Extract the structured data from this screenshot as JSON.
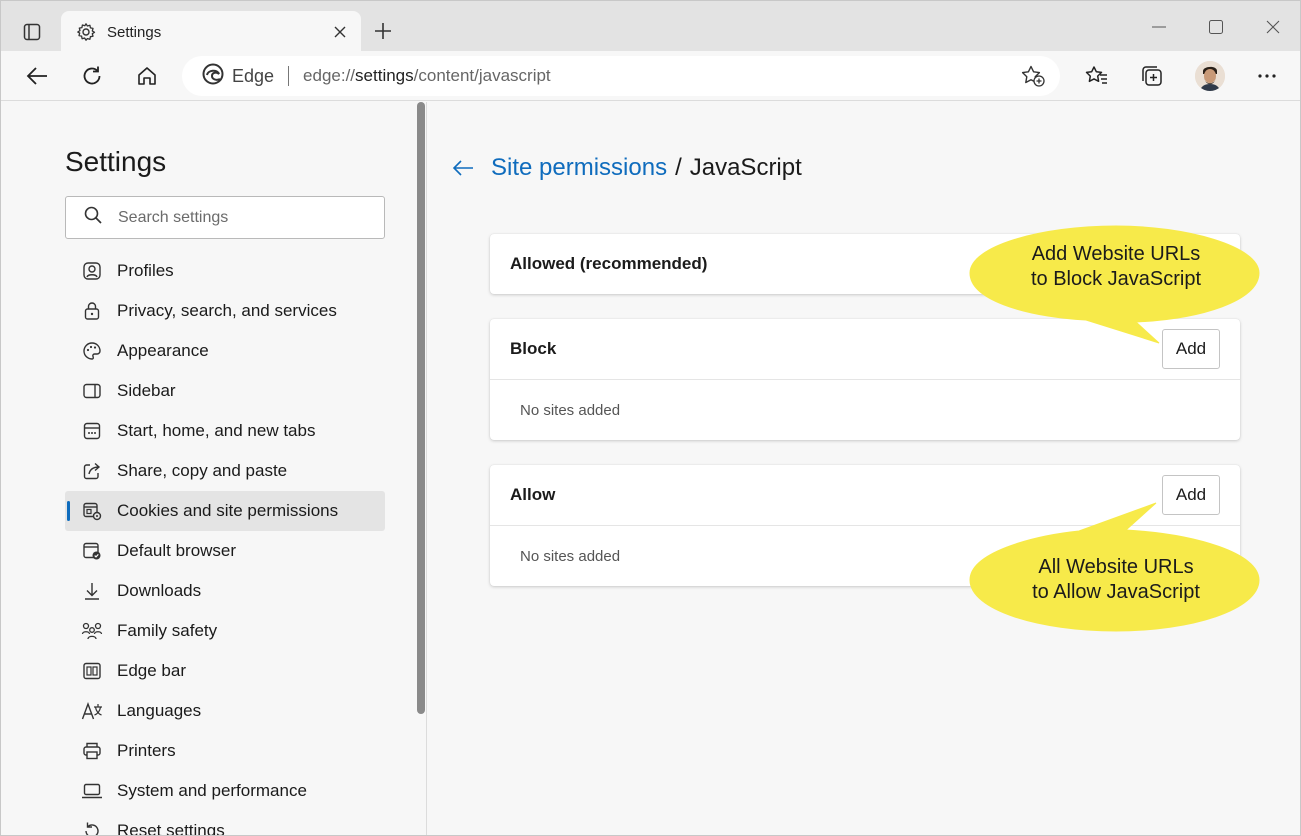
{
  "browser": {
    "tab_title": "Settings",
    "omnibox": {
      "brand": "Edge",
      "url_prefix": "edge://",
      "url_host": "settings",
      "url_path": "/content/javascript"
    }
  },
  "sidebar": {
    "title": "Settings",
    "search_placeholder": "Search settings",
    "items": [
      {
        "label": "Profiles",
        "icon": "profile-icon"
      },
      {
        "label": "Privacy, search, and services",
        "icon": "lock-icon"
      },
      {
        "label": "Appearance",
        "icon": "palette-icon"
      },
      {
        "label": "Sidebar",
        "icon": "sidebar-icon"
      },
      {
        "label": "Start, home, and new tabs",
        "icon": "home-tabs-icon"
      },
      {
        "label": "Share, copy and paste",
        "icon": "share-icon"
      },
      {
        "label": "Cookies and site permissions",
        "icon": "cookies-icon",
        "active": true
      },
      {
        "label": "Default browser",
        "icon": "default-browser-icon"
      },
      {
        "label": "Downloads",
        "icon": "download-icon"
      },
      {
        "label": "Family safety",
        "icon": "family-icon"
      },
      {
        "label": "Edge bar",
        "icon": "edge-bar-icon"
      },
      {
        "label": "Languages",
        "icon": "languages-icon"
      },
      {
        "label": "Printers",
        "icon": "printer-icon"
      },
      {
        "label": "System and performance",
        "icon": "laptop-icon"
      },
      {
        "label": "Reset settings",
        "icon": "reset-icon"
      }
    ]
  },
  "main": {
    "breadcrumb_link": "Site permissions",
    "breadcrumb_sep": "/",
    "breadcrumb_current": "JavaScript",
    "allowed_toggle_label": "Allowed (recommended)",
    "block": {
      "title": "Block",
      "add_label": "Add",
      "empty_text": "No sites added"
    },
    "allow": {
      "title": "Allow",
      "add_label": "Add",
      "empty_text": "No sites added"
    }
  },
  "callouts": {
    "block_line1": "Add Website URLs",
    "block_line2": "to Block JavaScript",
    "allow_line1": "All Website URLs",
    "allow_line2": "to Allow JavaScript",
    "color": "#f7ea4a"
  },
  "accent_color": "#0f6cbd"
}
